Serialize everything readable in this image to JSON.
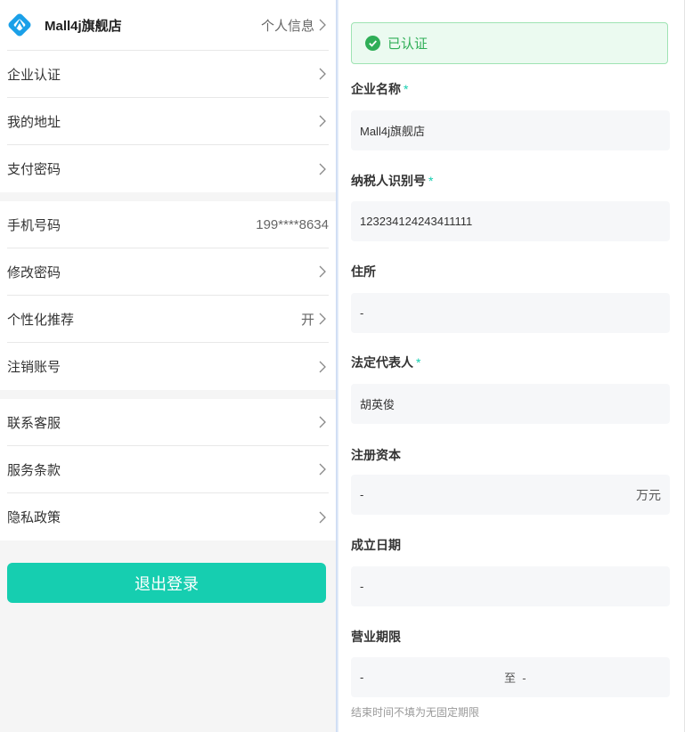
{
  "left": {
    "shop": {
      "name": "Mall4j旗舰店",
      "action": "个人信息"
    },
    "groups": [
      [
        {
          "label": "企业认证"
        },
        {
          "label": "我的地址"
        },
        {
          "label": "支付密码"
        }
      ],
      [
        {
          "label": "手机号码",
          "value": "199****8634"
        },
        {
          "label": "修改密码"
        },
        {
          "label": "个性化推荐",
          "value": "开"
        },
        {
          "label": "注销账号"
        }
      ],
      [
        {
          "label": "联系客服"
        },
        {
          "label": "服务条款"
        },
        {
          "label": "隐私政策"
        }
      ]
    ],
    "logout_label": "退出登录"
  },
  "right": {
    "status": "已认证",
    "fields": [
      {
        "label": "企业名称",
        "required": "*",
        "value": "Mall4j旗舰店"
      },
      {
        "label": "纳税人识别号",
        "required": "*",
        "value": "123234124243411111"
      },
      {
        "label": "住所",
        "value": "-"
      },
      {
        "label": "法定代表人",
        "required": "*",
        "value": "胡英俊"
      },
      {
        "label": "注册资本",
        "value": "-",
        "suffix": "万元"
      },
      {
        "label": "成立日期",
        "value": "-"
      },
      {
        "label": "营业期限",
        "value": "-",
        "separator": "至",
        "end": "-"
      }
    ],
    "hint": "结束时间不填为无固定期限"
  },
  "colors": {
    "accent": "#16ceb0",
    "success": "#2fae57"
  }
}
